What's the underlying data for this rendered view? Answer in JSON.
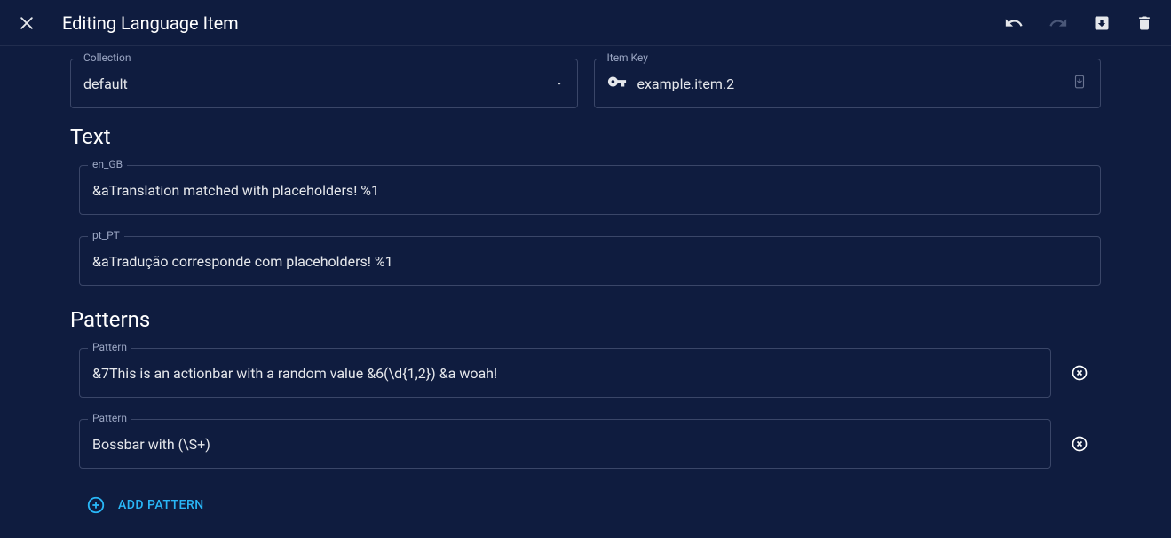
{
  "header": {
    "title": "Editing Language Item"
  },
  "collection": {
    "label": "Collection",
    "value": "default"
  },
  "itemKey": {
    "label": "Item Key",
    "value": "example.item.2"
  },
  "textSection": {
    "title": "Text",
    "fields": [
      {
        "label": "en_GB",
        "value": "&aTranslation matched with placeholders! %1"
      },
      {
        "label": "pt_PT",
        "value": "&aTradução corresponde com placeholders! %1"
      }
    ]
  },
  "patternsSection": {
    "title": "Patterns",
    "label": "Pattern",
    "items": [
      {
        "value": "&7This is an actionbar with a random value &6(\\d{1,2}) &a woah!"
      },
      {
        "value": "Bossbar with (\\S+)"
      }
    ],
    "addLabel": "ADD PATTERN"
  }
}
